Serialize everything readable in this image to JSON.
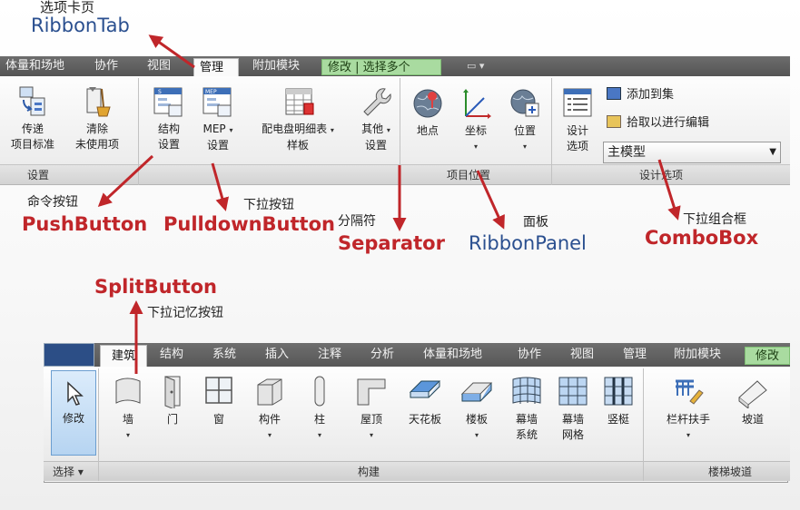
{
  "annotations": {
    "ribbon_tab_cn": "选项卡页",
    "ribbon_tab_en": "RibbonTab",
    "push_button_cn": "命令按钮",
    "push_button_en": "PushButton",
    "pulldown_button_cn": "下拉按钮",
    "pulldown_button_en": "PulldownButton",
    "separator_cn": "分隔符",
    "separator_en": "Separator",
    "ribbon_panel_cn": "面板",
    "ribbon_panel_en": "RibbonPanel",
    "combo_box_cn": "下拉组合框",
    "combo_box_en": "ComboBox",
    "split_button_en": "SplitButton",
    "split_button_cn": "下拉记忆按钮"
  },
  "ribbon1": {
    "tabs": [
      "体量和场地",
      "协作",
      "视图",
      "管理",
      "附加模块",
      "修改 | 选择多个",
      "▭ ▾"
    ],
    "active_tab": "管理",
    "buttons": {
      "transfer": [
        "传递",
        "项目标准"
      ],
      "purge": [
        "清除",
        "未使用项"
      ],
      "structural": [
        "结构",
        "设置"
      ],
      "mep": [
        "MEP",
        "设置"
      ],
      "panel_schedule": [
        "配电盘明细表",
        "样板"
      ],
      "other": [
        "其他",
        "设置"
      ],
      "location": "地点",
      "coordinates": "坐标",
      "position": "位置",
      "design_options": [
        "设计",
        "选项"
      ],
      "add_to_set": "添加到集",
      "pick_to_edit": "拾取以进行编辑",
      "main_model": "主模型"
    },
    "panels": [
      "设置",
      "项目位置",
      "设计选项"
    ]
  },
  "ribbon2": {
    "tabs": [
      "建筑",
      "结构",
      "系统",
      "插入",
      "注释",
      "分析",
      "体量和场地",
      "协作",
      "视图",
      "管理",
      "附加模块",
      "修改"
    ],
    "active_tab": "建筑",
    "buttons": {
      "modify": "修改",
      "wall": "墙",
      "door": "门",
      "window": "窗",
      "component": "构件",
      "column": "柱",
      "roof": "屋顶",
      "ceiling": "天花板",
      "floor": "楼板",
      "curtain_system": [
        "幕墙",
        "系统"
      ],
      "curtain_grid": [
        "幕墙",
        "网格"
      ],
      "mullion": "竖梃",
      "railing": "栏杆扶手",
      "ramp": "坡道"
    },
    "panels": [
      "选择 ▾",
      "构建",
      "楼梯坡道"
    ]
  },
  "colors": {
    "annotation_red": "#c0262a",
    "annotation_blue": "#2a4f8f",
    "modify_tab": "#a9dba0",
    "tabbar": "#5f5f5f"
  }
}
